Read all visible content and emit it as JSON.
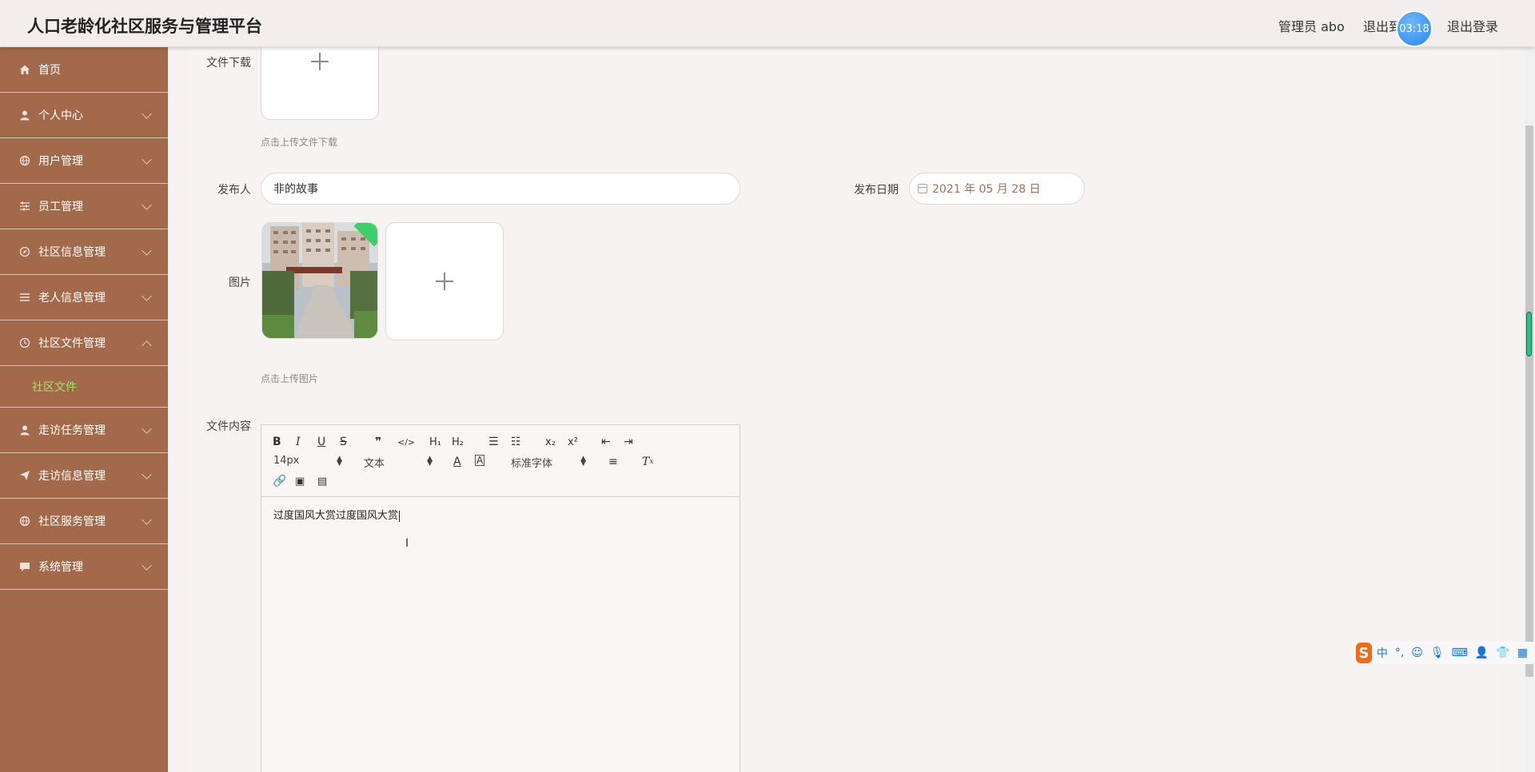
{
  "header": {
    "title": "人口老龄化社区服务与管理平台",
    "user": "管理员 abo",
    "exit_front": "退出到前台",
    "logout": "退出登录",
    "timer": "03:18"
  },
  "sidebar": {
    "items": [
      {
        "label": "首页",
        "icon": "home-icon"
      },
      {
        "label": "个人中心",
        "icon": "user-icon"
      },
      {
        "label": "用户管理",
        "icon": "globe-icon"
      },
      {
        "label": "员工管理",
        "icon": "sliders-icon"
      },
      {
        "label": "社区信息管理",
        "icon": "compass-icon"
      },
      {
        "label": "老人信息管理",
        "icon": "list-icon"
      },
      {
        "label": "社区文件管理",
        "icon": "clock-icon"
      },
      {
        "label": "走访任务管理",
        "icon": "user-icon"
      },
      {
        "label": "走访信息管理",
        "icon": "send-icon"
      },
      {
        "label": "社区服务管理",
        "icon": "globe-icon"
      },
      {
        "label": "系统管理",
        "icon": "chat-icon"
      }
    ],
    "active_sub": "社区文件"
  },
  "form": {
    "file_download_label": "文件下载",
    "file_download_hint": "点击上传文件下载",
    "publisher_label": "发布人",
    "publisher_value": "非的故事",
    "date_label": "发布日期",
    "date_value": "2021 年 05 月 28 日",
    "image_label": "图片",
    "image_hint": "点击上传图片",
    "content_label": "文件内容"
  },
  "editor": {
    "font_size": "14px",
    "format": "文本",
    "font": "标准字体",
    "content": "过度国风大赏过度国风大赏"
  },
  "ime": {
    "logo": "S",
    "mode": "中",
    "punct": "°,"
  }
}
